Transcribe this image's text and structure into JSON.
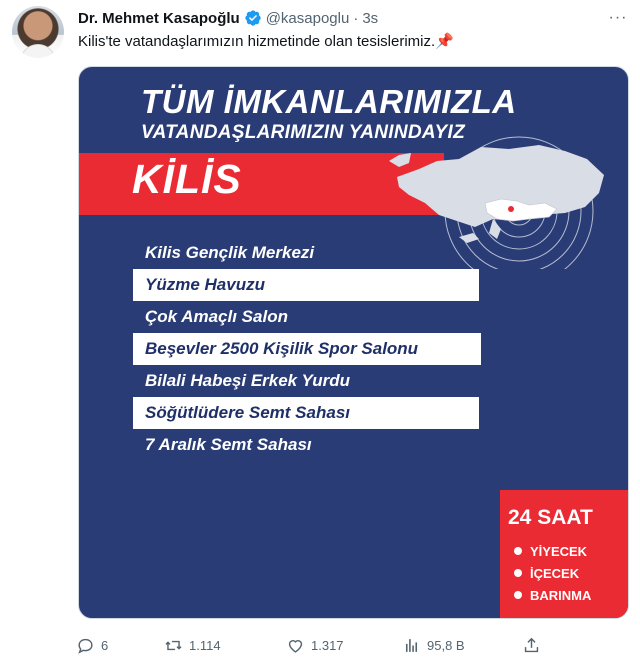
{
  "tweet": {
    "author_name": "Dr. Mehmet Kasapoğlu",
    "handle": "@kasapoglu",
    "separator": "·",
    "time": "3s",
    "more_label": "···",
    "text": "Kilis'te vatandaşlarımızın hizmetinde olan tesislerimiz.",
    "text_emoji": "📌"
  },
  "media": {
    "title_line1": "TÜM İMKANLARIMIZLA",
    "title_line2": "VATANDAŞLARIMIZIN YANINDAYIZ",
    "city": "KİLİS",
    "facilities": [
      "Kilis Gençlik Merkezi",
      "Yüzme Havuzu",
      "Çok Amaçlı Salon",
      "Beşevler 2500 Kişilik Spor Salonu",
      "Bilali Habeşi Erkek Yurdu",
      "Söğütlüdere Semt Sahası",
      "7 Aralık Semt Sahası"
    ],
    "badge_title": "24 SAAT",
    "badge_items": [
      "YİYECEK",
      "İÇECEK",
      "BARINMA"
    ],
    "colors": {
      "navy": "#2a3c75",
      "red": "#ea2b33",
      "white": "#ffffff"
    }
  },
  "actions": {
    "replies": "6",
    "retweets": "1.114",
    "likes": "1.317",
    "views": "95,8 B"
  },
  "icons": {
    "verified": "verified-badge-icon",
    "reply": "reply-icon",
    "retweet": "retweet-icon",
    "like": "heart-icon",
    "views": "views-icon",
    "share": "share-icon"
  }
}
